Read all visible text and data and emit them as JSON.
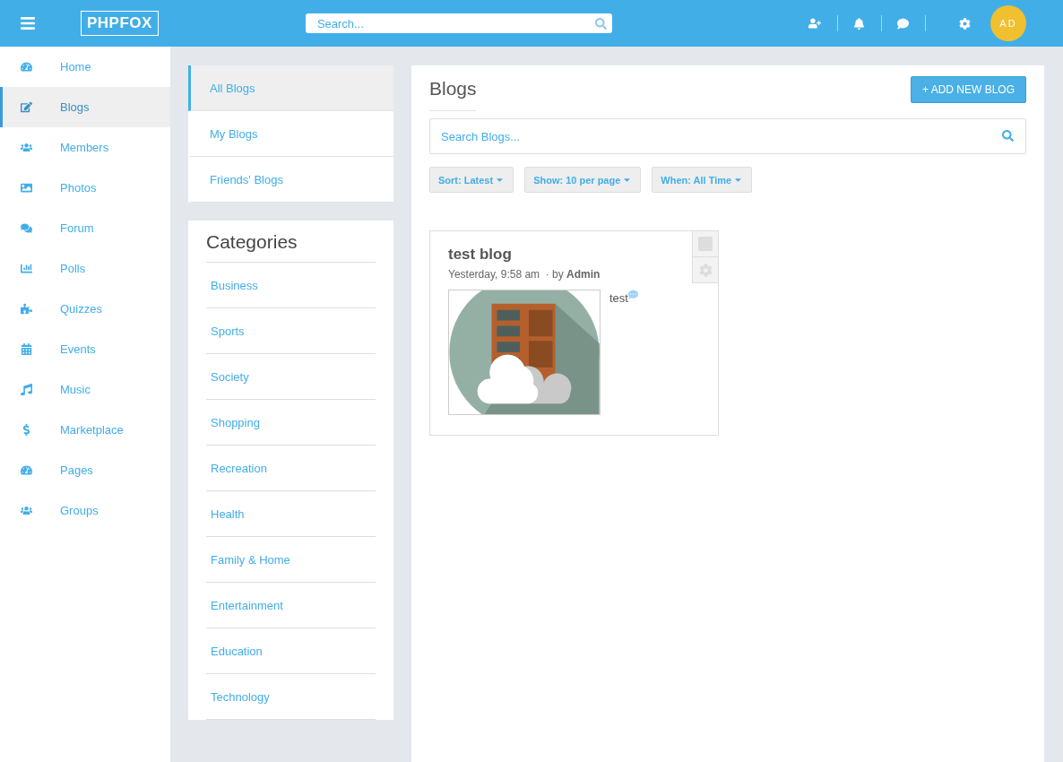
{
  "topbar": {
    "logo": "PHPFOX",
    "search": {
      "placeholder": "Search..."
    },
    "avatar": "AD"
  },
  "sidebar": {
    "items": [
      {
        "label": "Home",
        "selected": false
      },
      {
        "label": "Blogs",
        "selected": true
      },
      {
        "label": "Members",
        "selected": false
      },
      {
        "label": "Photos",
        "selected": false
      },
      {
        "label": "Forum",
        "selected": false
      },
      {
        "label": "Polls",
        "selected": false
      },
      {
        "label": "Quizzes",
        "selected": false
      },
      {
        "label": "Events",
        "selected": false
      },
      {
        "label": "Music",
        "selected": false
      },
      {
        "label": "Marketplace",
        "selected": false
      },
      {
        "label": "Pages",
        "selected": false
      },
      {
        "label": "Groups",
        "selected": false
      }
    ]
  },
  "blog_menu": [
    {
      "label": "All Blogs",
      "selected": true
    },
    {
      "label": "My Blogs",
      "selected": false
    },
    {
      "label": "Friends' Blogs",
      "selected": false
    }
  ],
  "categories": {
    "title": "Categories",
    "items": [
      "Business",
      "Sports",
      "Society",
      "Shopping",
      "Recreation",
      "Health",
      "Family & Home",
      "Entertainment",
      "Education",
      "Technology"
    ]
  },
  "main": {
    "title": "Blogs",
    "add_button": "+ ADD NEW BLOG",
    "search": {
      "placeholder": "Search Blogs..."
    },
    "filters": [
      "Sort: Latest",
      "Show: 10 per page",
      "When: All Time"
    ],
    "blogs": [
      {
        "title": "test blog",
        "meta": "Yesterday, 9:58 am  · by **Admin**",
        "excerpt": "test",
        "checked": false
      }
    ]
  }
}
